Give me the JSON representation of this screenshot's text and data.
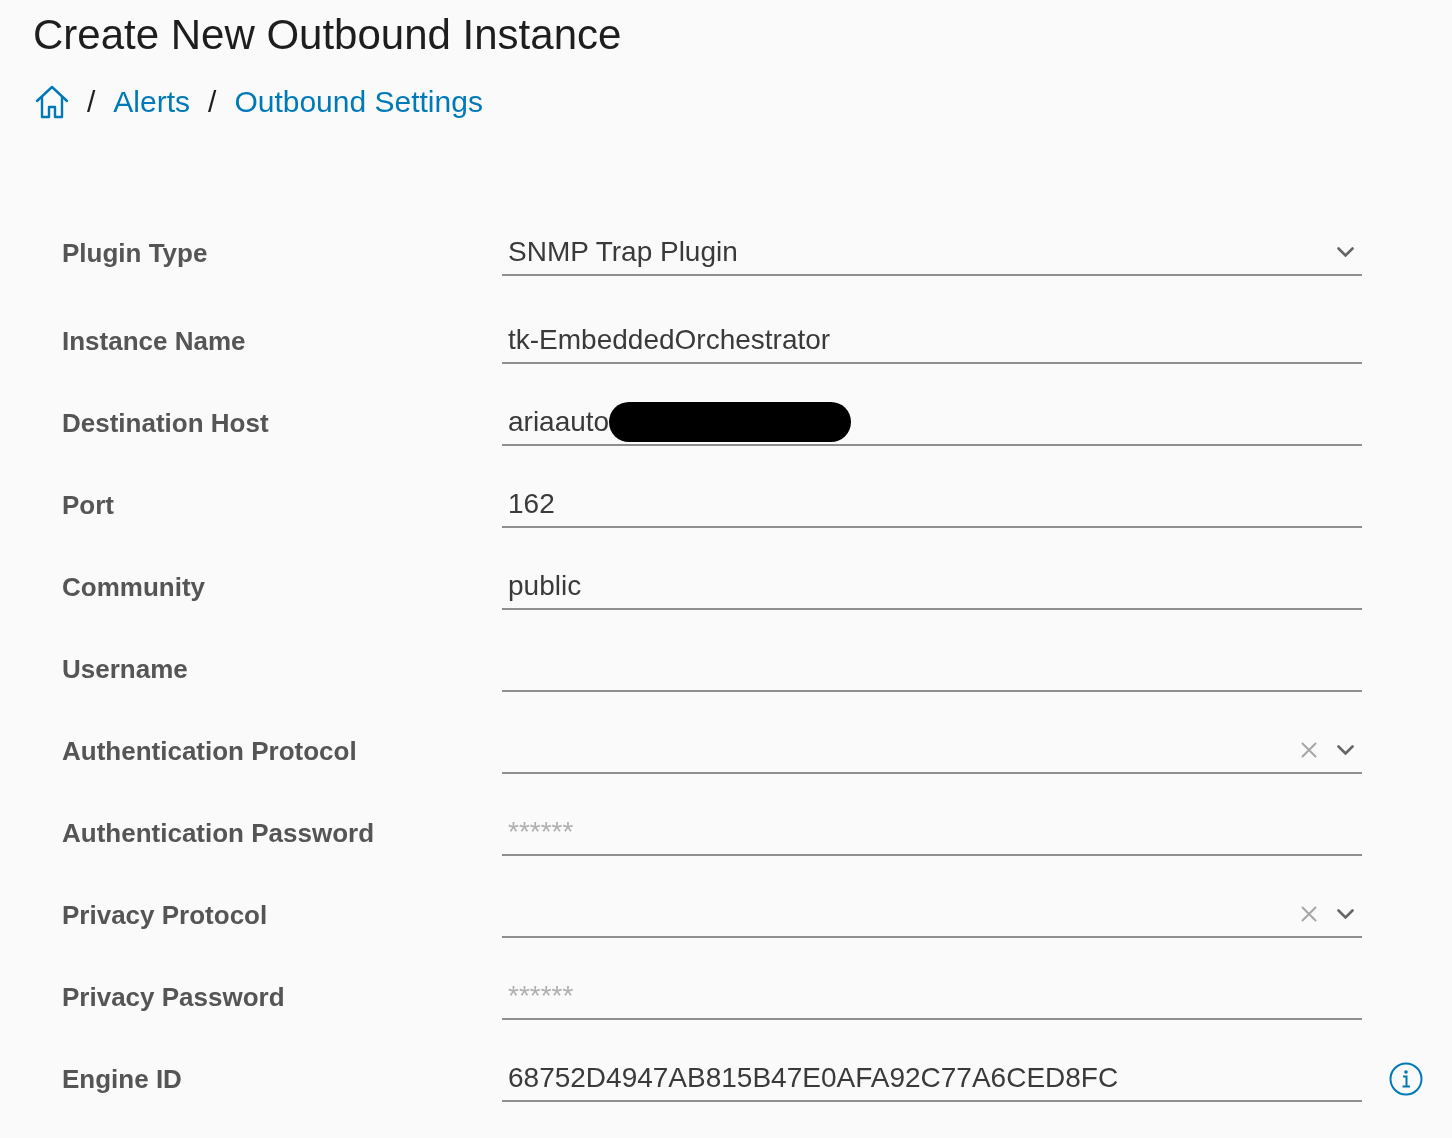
{
  "title": "Create New Outbound Instance",
  "breadcrumb": [
    {
      "kind": "home"
    },
    {
      "kind": "separator",
      "text": "/"
    },
    {
      "kind": "link",
      "label": "Alerts"
    },
    {
      "kind": "separator",
      "text": "/"
    },
    {
      "kind": "link",
      "label": "Outbound Settings"
    }
  ],
  "fields": [
    {
      "label": "Plugin Type",
      "kind": "select",
      "value": "SNMP Trap Plugin",
      "clearable": false,
      "info": false
    },
    {
      "label": "Instance Name",
      "kind": "text",
      "value": "tk-EmbeddedOrchestrator",
      "info": false
    },
    {
      "label": "Destination Host",
      "kind": "text",
      "value": "ariaauto",
      "redacted": true,
      "info": false
    },
    {
      "label": "Port",
      "kind": "text",
      "value": "162",
      "info": false
    },
    {
      "label": "Community",
      "kind": "text",
      "value": "public",
      "info": false
    },
    {
      "label": "Username",
      "kind": "text",
      "info": false
    },
    {
      "label": "Authentication Protocol",
      "kind": "select",
      "clearable": true,
      "info": false
    },
    {
      "label": "Authentication Password",
      "kind": "password",
      "placeholder": "******",
      "info": false
    },
    {
      "label": "Privacy Protocol",
      "kind": "select",
      "clearable": true,
      "info": false
    },
    {
      "label": "Privacy Password",
      "kind": "password",
      "placeholder": "******",
      "info": false
    },
    {
      "label": "Engine ID",
      "kind": "text",
      "value": "68752D4947AB815B47E0AFA92C77A6CED8FC",
      "info": true
    }
  ]
}
